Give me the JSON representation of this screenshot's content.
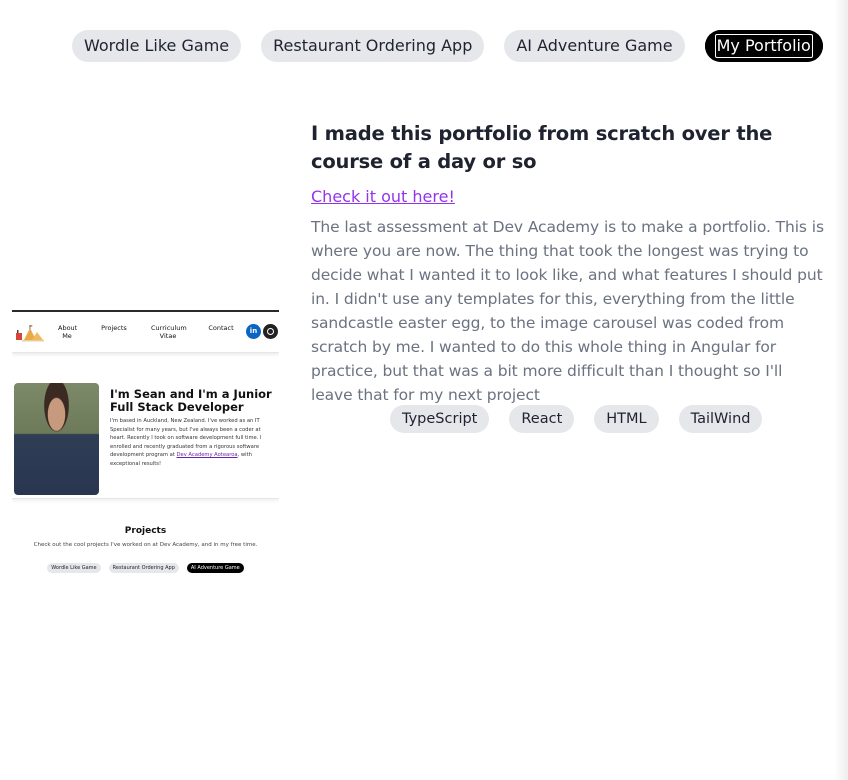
{
  "tabs": [
    {
      "label": "Wordle Like Game",
      "active": false
    },
    {
      "label": "Restaurant Ordering App",
      "active": false
    },
    {
      "label": "AI Adventure Game",
      "active": false
    },
    {
      "label": "My Portfolio",
      "active": true
    }
  ],
  "project": {
    "heading": "I made this portfolio from scratch over the course of a day or so",
    "link_text": "Check it out here!",
    "description": "The last assessment at Dev Academy is to make a portfolio. This is where you are now. The thing that took the longest was trying to decide what I wanted it to look like, and what features I should put in. I didn't use any templates for this, everything from the little sandcastle easter egg, to the image carousel was coded from scratch by me. I wanted to do this whole thing in Angular for practice, but that was a bit more difficult than I thought so I'll leave that for my next project",
    "tags": [
      "TypeScript",
      "React",
      "HTML",
      "TailWind"
    ]
  },
  "preview": {
    "nav": [
      "About Me",
      "Projects",
      "Curriculum Vitae",
      "Contact"
    ],
    "linkedin_label": "in",
    "hero_title": "I'm Sean and I'm a Junior Full Stack Developer",
    "hero_text": "I'm based in Auckland, New Zealand. I've worked as an IT Specialist for many years, but I've always been a coder at heart. Recently I took on software development full time. I enrolled and recently graduated from a rigorous software development program at ",
    "hero_link": "Dev Academy Aotearoa",
    "hero_text_end": ", with exceptional results!",
    "projects_title": "Projects",
    "projects_sub": "Check out the cool projects I've worked on at Dev Academy, and in my free time.",
    "tabs": [
      "Wordle Like Game",
      "Restaurant Ordering App",
      "AI Adventure Game"
    ]
  },
  "colors": {
    "link": "#9333ea",
    "active_tab": "#000000",
    "tag_bg": "#e5e7eb",
    "linkedin": "#0a66c2"
  }
}
